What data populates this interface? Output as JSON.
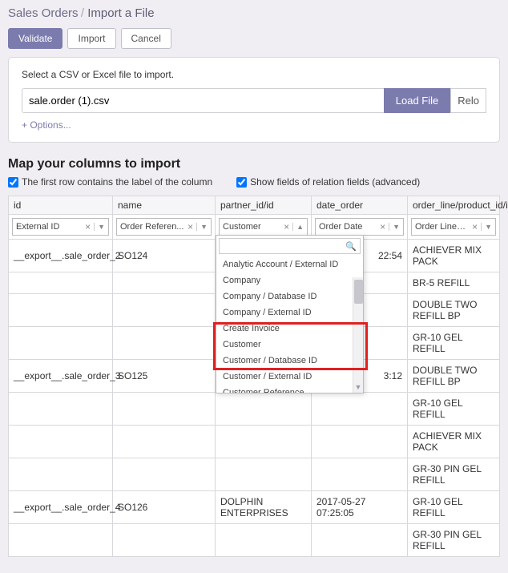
{
  "breadcrumb": {
    "parent": "Sales Orders",
    "sep": " / ",
    "current": "Import a File"
  },
  "toolbar": {
    "validate": "Validate",
    "import": "Import",
    "cancel": "Cancel"
  },
  "panel": {
    "instruction": "Select a CSV or Excel file to import.",
    "file_value": "sale.order (1).csv",
    "load": "Load File",
    "reload": "Relo",
    "options": "+ Options..."
  },
  "section_title": "Map your columns to import",
  "checks": {
    "first_row": "The first row contains the label of the column",
    "show_fields": "Show fields of relation fields (advanced)"
  },
  "headers": [
    "id",
    "name",
    "partner_id/id",
    "date_order",
    "order_line/product_id/id"
  ],
  "selectors": [
    "External ID",
    "Order Referen...",
    "Customer",
    "Order Date",
    "Order Lines / ..."
  ],
  "rows": [
    [
      "__export__.sale_order_2",
      "SO124",
      "",
      "",
      "ACHIEVER MIX PACK"
    ],
    [
      "",
      "",
      "",
      "",
      "BR-5 REFILL"
    ],
    [
      "",
      "",
      "",
      "",
      "DOUBLE TWO REFILL BP"
    ],
    [
      "",
      "",
      "",
      "",
      "GR-10 GEL REFILL"
    ],
    [
      "__export__.sale_order_3",
      "SO125",
      "",
      "",
      "DOUBLE TWO REFILL BP"
    ],
    [
      "",
      "",
      "",
      "",
      "GR-10 GEL REFILL"
    ],
    [
      "",
      "",
      "",
      "",
      "ACHIEVER MIX PACK"
    ],
    [
      "",
      "",
      "",
      "",
      "GR-30 PIN GEL REFILL"
    ],
    [
      "__export__.sale_order_4",
      "SO126",
      "DOLPHIN ENTERPRISES",
      "2017-05-27 07:25:05",
      "GR-10 GEL REFILL"
    ],
    [
      "",
      "",
      "",
      "",
      "GR-30 PIN GEL REFILL"
    ]
  ],
  "row0_date_partial": "22:54",
  "row4_date_partial": "3:12",
  "dropdown": {
    "items": [
      "Analytic Account / External ID",
      "Company",
      "Company / Database ID",
      "Company / External ID",
      "Create Invoice",
      "Customer",
      "Customer / Database ID",
      "Customer / External ID",
      "Customer Reference"
    ]
  }
}
